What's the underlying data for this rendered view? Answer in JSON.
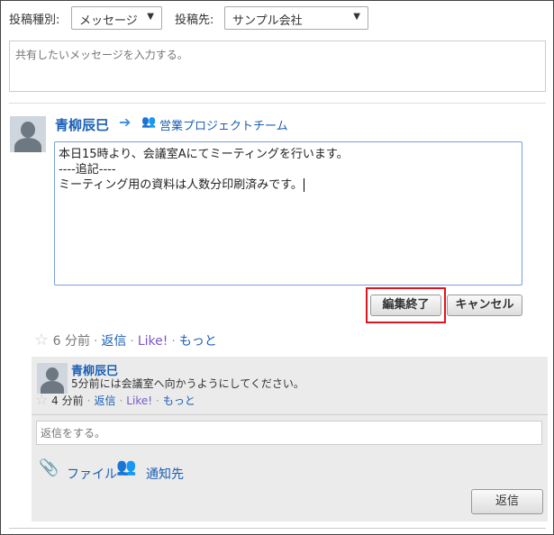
{
  "composer": {
    "type_label": "投稿種別:",
    "type_value": "メッセージ",
    "dest_label": "投稿先:",
    "dest_value": "サンプル会社",
    "placeholder": "共有したいメッセージを入力する。"
  },
  "post": {
    "author": "青柳辰巳",
    "group": "営業プロジェクトチーム",
    "edit_lines": [
      "本日15時より、会議室Aにてミーティングを行います。",
      "----追記----",
      "ミーティング用の資料は人数分印刷済みです。"
    ],
    "finish_edit": "編集終了",
    "cancel": "キャンセル",
    "time": "6 分前",
    "reply": "返信",
    "like": "Like!",
    "more": "もっと"
  },
  "comment": {
    "author": "青柳辰巳",
    "text": "5分前には会議室へ向かうようにしてください。",
    "time": "4 分前",
    "reply": "返信",
    "like": "Like!",
    "more": "もっと"
  },
  "reply_box": {
    "placeholder": "返信をする。",
    "file": "ファイル",
    "notify": "通知先",
    "submit": "返信"
  },
  "colors": {
    "highlight": "#e0141e",
    "link": "#1a5fb4"
  }
}
